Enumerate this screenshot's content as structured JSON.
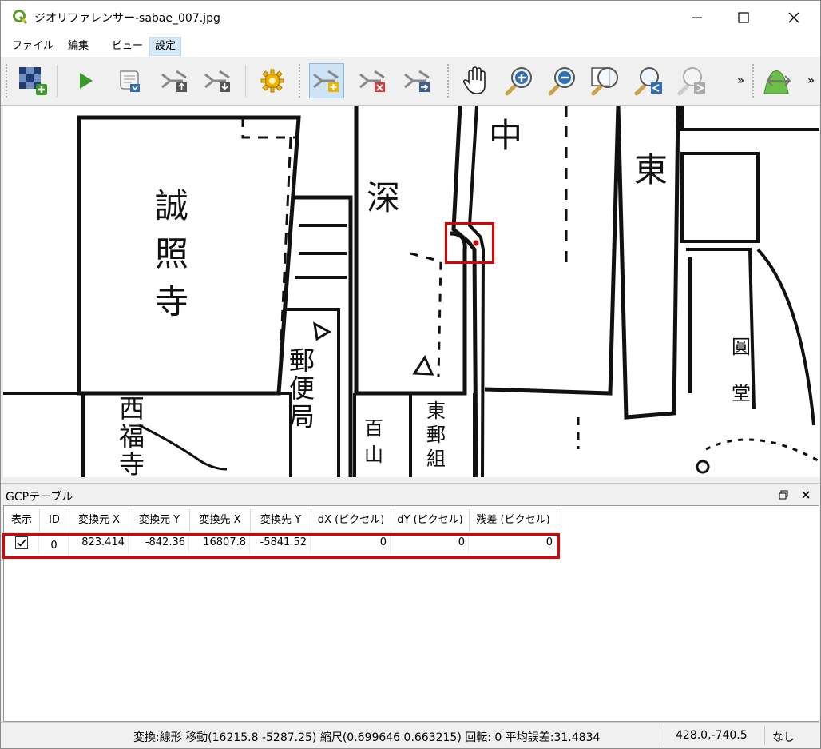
{
  "window": {
    "title": "ジオリファレンサー-sabae_007.jpg"
  },
  "menu": {
    "items": [
      "ファイル",
      "編集",
      "ビュー",
      "設定"
    ],
    "active": "設定"
  },
  "toolbar": {
    "overflow_label_1": "»",
    "overflow_label_2": "»",
    "icons": [
      "open-raster-icon",
      "start-georeferencing-icon",
      "generate-gdal-script-icon",
      "load-gcp-points-icon",
      "save-gcp-points-icon",
      "transformation-settings-icon",
      "add-point-icon",
      "delete-point-icon",
      "move-gcp-point-icon",
      "pan-icon",
      "zoom-in-icon",
      "zoom-out-icon",
      "zoom-to-layer-icon",
      "zoom-last-icon",
      "zoom-next-icon",
      "link-georeferencer-to-qgis-icon"
    ],
    "pressed": "add-point-icon"
  },
  "map": {
    "labels": [
      "中",
      "東",
      "深",
      "誠",
      "照",
      "寺",
      "郵",
      "便",
      "局",
      "西",
      "福",
      "寺",
      "百",
      "山",
      "東",
      "郵",
      "組",
      "圓",
      "堂"
    ],
    "point_marker_color": "#e00000"
  },
  "gcp_panel": {
    "title": "GCPテーブル",
    "columns": [
      "表示",
      "ID",
      "変換元 X",
      "変換元 Y",
      "変換先 X",
      "変換先 Y",
      "dX (ピクセル)",
      "dY (ピクセル)",
      "残差 (ピクセル)"
    ],
    "rows": [
      {
        "enabled": true,
        "id": "0",
        "src_x": "823.414",
        "src_y": "-842.36",
        "dst_x": "16807.8",
        "dst_y": "-5841.52",
        "dx": "0",
        "dy": "0",
        "residual": "0"
      }
    ]
  },
  "status": {
    "transform": "変換:線形 移動(16215.8 -5287.25) 縮尺(0.699646 0.663215) 回転: 0 平均誤差:31.4834",
    "coords": "428.0,-740.5",
    "crs": "なし"
  },
  "colors": {
    "highlight": "#e00000",
    "accent": "#cde4f7",
    "qgis_green": "#5a9e2f"
  }
}
